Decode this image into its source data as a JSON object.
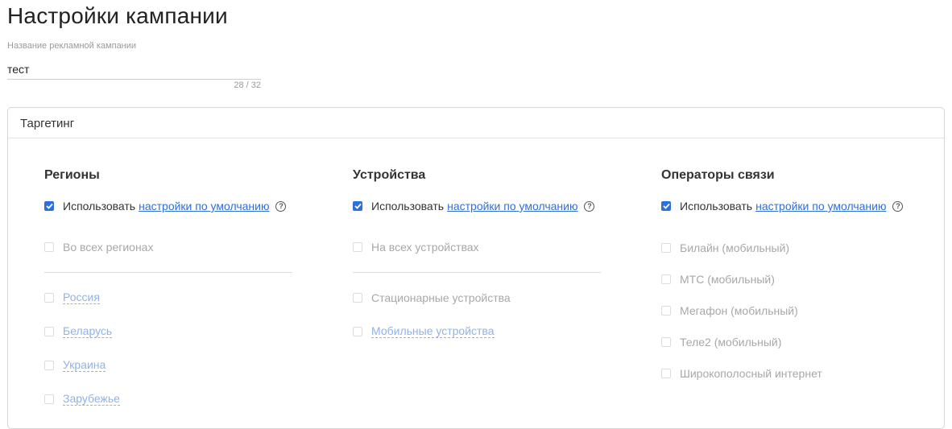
{
  "page": {
    "title": "Настройки кампании"
  },
  "campaign_name": {
    "label": "Название рекламной кампании",
    "value": "тест",
    "counter": "28 / 32"
  },
  "targeting": {
    "title": "Таргетинг",
    "use_label": "Использовать",
    "default_link": "настройки по умолчанию",
    "help_glyph": "?",
    "regions": {
      "title": "Регионы",
      "use_default_checked": true,
      "all_label": "Во всех регионах",
      "items": [
        "Россия",
        "Беларусь",
        "Украина",
        "Зарубежье"
      ]
    },
    "devices": {
      "title": "Устройства",
      "use_default_checked": true,
      "all_label": "На всех устройствах",
      "items": [
        "Стационарные устройства",
        "Мобильные устройства"
      ]
    },
    "operators": {
      "title": "Операторы связи",
      "use_default_checked": true,
      "items": [
        "Билайн (мобильный)",
        "МТС (мобильный)",
        "Мегафон (мобильный)",
        "Теле2 (мобильный)",
        "Широкополосный интернет"
      ]
    }
  },
  "colors": {
    "accent": "#2f6fdc",
    "disabled_link": "#8fb3e8",
    "disabled_text": "#a8a8a8"
  }
}
